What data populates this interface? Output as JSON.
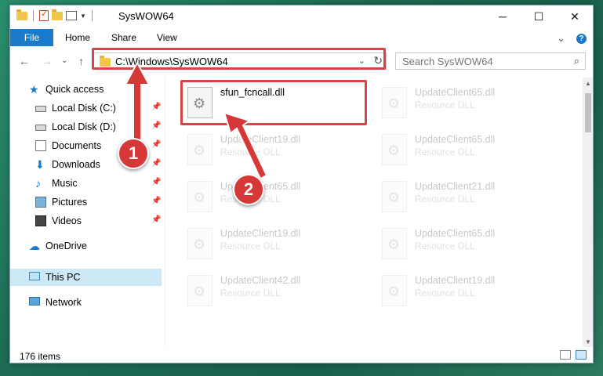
{
  "window": {
    "title": "SysWOW64",
    "controls": {
      "minimize": "─",
      "maximize": "☐",
      "close": "✕"
    }
  },
  "ribbon": {
    "file_label": "File",
    "tabs": [
      "Home",
      "Share",
      "View"
    ],
    "expand_icon": "⌄",
    "help_icon": "?"
  },
  "address": {
    "path": "C:\\Windows\\SysWOW64",
    "dropdown": "⌄",
    "refresh": "↻"
  },
  "nav_buttons": {
    "back": "←",
    "forward": "→",
    "recent": "⌄",
    "up": "↑"
  },
  "search": {
    "placeholder": "Search SysWOW64",
    "icon": "⌕"
  },
  "sidebar": {
    "items": [
      {
        "label": "Quick access",
        "icon": "quick-access-icon",
        "pinned": false
      },
      {
        "label": "Local Disk (C:)",
        "icon": "drive-icon",
        "pinned": true
      },
      {
        "label": "Local Disk (D:)",
        "icon": "drive-icon",
        "pinned": true
      },
      {
        "label": "Documents",
        "icon": "documents-icon",
        "pinned": true
      },
      {
        "label": "Downloads",
        "icon": "downloads-icon",
        "pinned": true
      },
      {
        "label": "Music",
        "icon": "music-icon",
        "pinned": true
      },
      {
        "label": "Pictures",
        "icon": "pictures-icon",
        "pinned": true
      },
      {
        "label": "Videos",
        "icon": "videos-icon",
        "pinned": true
      },
      {
        "label": "OneDrive",
        "icon": "onedrive-icon",
        "pinned": false
      },
      {
        "label": "This PC",
        "icon": "this-pc-icon",
        "pinned": false,
        "selected": true
      },
      {
        "label": "Network",
        "icon": "network-icon",
        "pinned": false
      }
    ]
  },
  "files": [
    {
      "name": "sfun_fcncall.dll",
      "type": "",
      "highlighted": true
    },
    {
      "name": "UpdateClient65.dll",
      "type": "Resource DLL"
    },
    {
      "name": "UpdateClient19.dll",
      "type": "Resource DLL"
    },
    {
      "name": "UpdateClient65.dll",
      "type": "Resource DLL"
    },
    {
      "name": "UpdateClient65.dll",
      "type": "Resource DLL"
    },
    {
      "name": "UpdateClient21.dll",
      "type": "Resource DLL"
    },
    {
      "name": "UpdateClient19.dll",
      "type": "Resource DLL"
    },
    {
      "name": "UpdateClient65.dll",
      "type": "Resource DLL"
    },
    {
      "name": "UpdateClient42.dll",
      "type": "Resource DLL"
    },
    {
      "name": "UpdateClient19.dll",
      "type": "Resource DLL"
    }
  ],
  "status": {
    "item_count": "176 items"
  },
  "annotations": {
    "step1": "1",
    "step2": "2",
    "color": "#d64545"
  }
}
